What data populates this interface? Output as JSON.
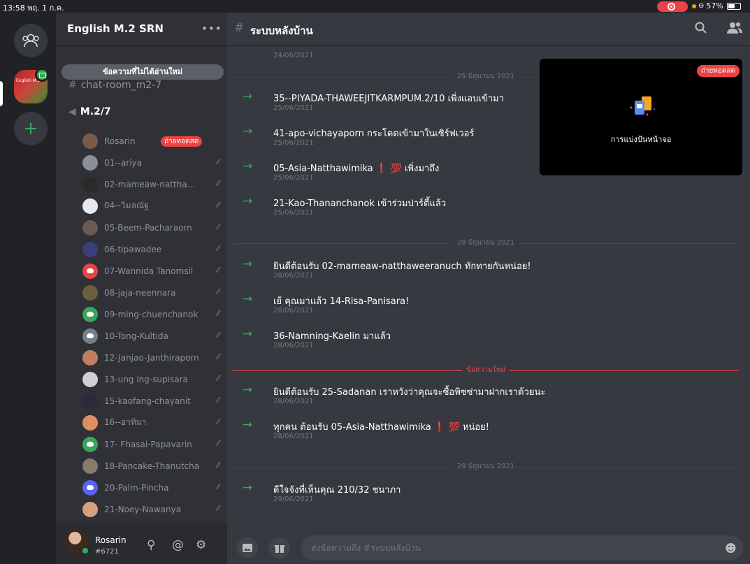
{
  "status_bar": {
    "time_date": "13:58  พฤ. 1 ก.ค.",
    "battery": "57%",
    "battery_level": 0.57
  },
  "rail": {
    "server_label": "English M.2"
  },
  "sidebar": {
    "server_name": "English M.2 SRN",
    "more": "•••",
    "unread_banner": "ข้อความที่ไม่ได้อ่านใหม่",
    "text_channel": "chat-room_m2-7",
    "voice_channel": "M.2/7",
    "live_badge": "ถ่ายทอดสด",
    "members": [
      {
        "name": "Rosarin",
        "live": true
      },
      {
        "name": "01--ariya"
      },
      {
        "name": "02-mameaw-nattha..."
      },
      {
        "name": "04--วิมลณัฐ"
      },
      {
        "name": "05-Beem-Pacharaorn"
      },
      {
        "name": "06-tipawadee"
      },
      {
        "name": "07-Wannida Tanomsil"
      },
      {
        "name": "08-jaja-neennara"
      },
      {
        "name": "09-ming-chuenchanok"
      },
      {
        "name": "10-Tong-Kultida"
      },
      {
        "name": "12-Janjao-Janthiraporn"
      },
      {
        "name": "13-ung ing-supisara"
      },
      {
        "name": "15-kaofang-chayanit"
      },
      {
        "name": "16--อาทิมา"
      },
      {
        "name": "17- Fhasai-Papavarin"
      },
      {
        "name": "18-Pancake-Thanutcha"
      },
      {
        "name": "20-Palm-Pincha"
      },
      {
        "name": "21-Noey-Nawanya"
      }
    ]
  },
  "user_panel": {
    "name": "Rosarin",
    "tag": "#6721"
  },
  "main": {
    "channel_name": "ระบบหลังบ้าน",
    "top_date": "24/06/2021",
    "dividers": {
      "d1": "25 มิถุนายน 2021",
      "d2": "28 มิถุนายน 2021",
      "new": "ข้อความใหม่",
      "d3": "29 มิถุนายน 2021"
    },
    "messages": [
      {
        "text": "35--PIYADA-THAWEEJITKARMPUM.2/10 เพิ่งแอบเข้ามา",
        "date": "25/06/2021"
      },
      {
        "text": "41-apo-vichayaporn กระโดดเข้ามาในเซิร์ฟเวอร์",
        "date": "25/06/2021"
      },
      {
        "text_a": "05-Asia-Natthawimika",
        "emoji": "❗ 💯",
        "text_b": "เพิ่งมาถึง",
        "date": "25/06/2021"
      },
      {
        "text": "21-Kao-Thananchanok เข้าร่วมปาร์ตี้แล้ว",
        "date": "25/06/2021"
      },
      {
        "text": "ยินดีต้อนรับ 02-mameaw-natthaweeranuch ทักทายกันหน่อย!",
        "date": "28/06/2021"
      },
      {
        "text": "เย้ คุณมาแล้ว 14-Risa-Panisara!",
        "date": "28/06/2021"
      },
      {
        "text": "36-Namning-Kaelin มาแล้ว",
        "date": "28/06/2021"
      },
      {
        "text": "ยินดีต้อนรับ 25-Sadanan เราหวังว่าคุณจะซื้อพิซซ่ามาฝากเราด้วยนะ",
        "date": "28/06/2021"
      },
      {
        "text_a": "ทุกคน ต้อนรับ 05-Asia-Natthawimika",
        "emoji": "❗ 💯",
        "text_b": "หน่อย!",
        "date": "28/06/2021"
      },
      {
        "text": "ดีใจจังที่เห็นคุณ 210/32 ชนาภา",
        "date": "29/06/2021"
      }
    ],
    "screen_share": {
      "live": "ถ่ายทอดสด",
      "label": "การแบ่งปันหน้าจอ"
    },
    "composer_placeholder": "ส่งข้อความถึง #ระบบหลังบ้าน"
  },
  "colors": {
    "accent_green": "#3ba55c",
    "live_red": "#ed4245",
    "blurple": "#5865f2"
  },
  "icons": [
    "friends-icon",
    "plus-icon",
    "hash-icon",
    "speaker-icon",
    "deafened-icon",
    "search-icon",
    "members-icon",
    "image-icon",
    "gift-icon",
    "emoji-icon",
    "at-icon",
    "gear-icon",
    "user-search-icon"
  ]
}
